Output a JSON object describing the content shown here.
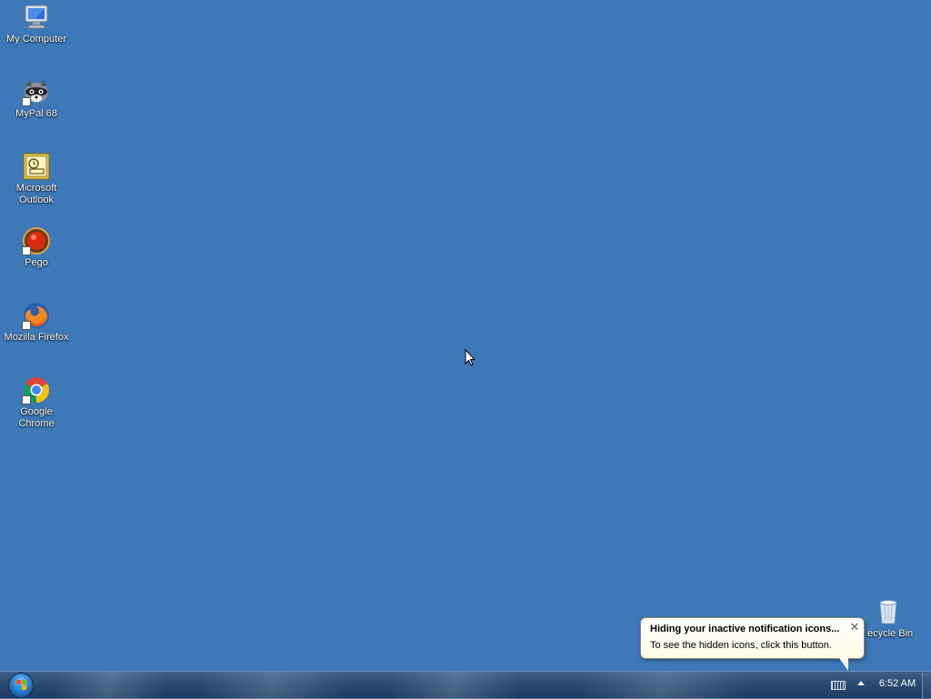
{
  "desktop": {
    "icons": [
      {
        "label": "My Computer",
        "icon": "computer-icon"
      },
      {
        "label": "MyPal 68",
        "icon": "raccoon-icon"
      },
      {
        "label": "Microsoft Outlook",
        "icon": "outlook-icon"
      },
      {
        "label": "Pego",
        "icon": "pego-icon"
      },
      {
        "label": "Mozilla Firefox",
        "icon": "firefox-icon"
      },
      {
        "label": "Google Chrome",
        "icon": "chrome-icon"
      },
      {
        "label": "ecycle Bin",
        "icon": "recycle-bin-icon"
      }
    ],
    "background_color": "#3d78b8"
  },
  "notification": {
    "title": "Hiding your inactive notification icons...",
    "text": "To see the hidden icons, click this button.",
    "close_glyph": "✕"
  },
  "taskbar": {
    "clock": "6:52 AM"
  }
}
